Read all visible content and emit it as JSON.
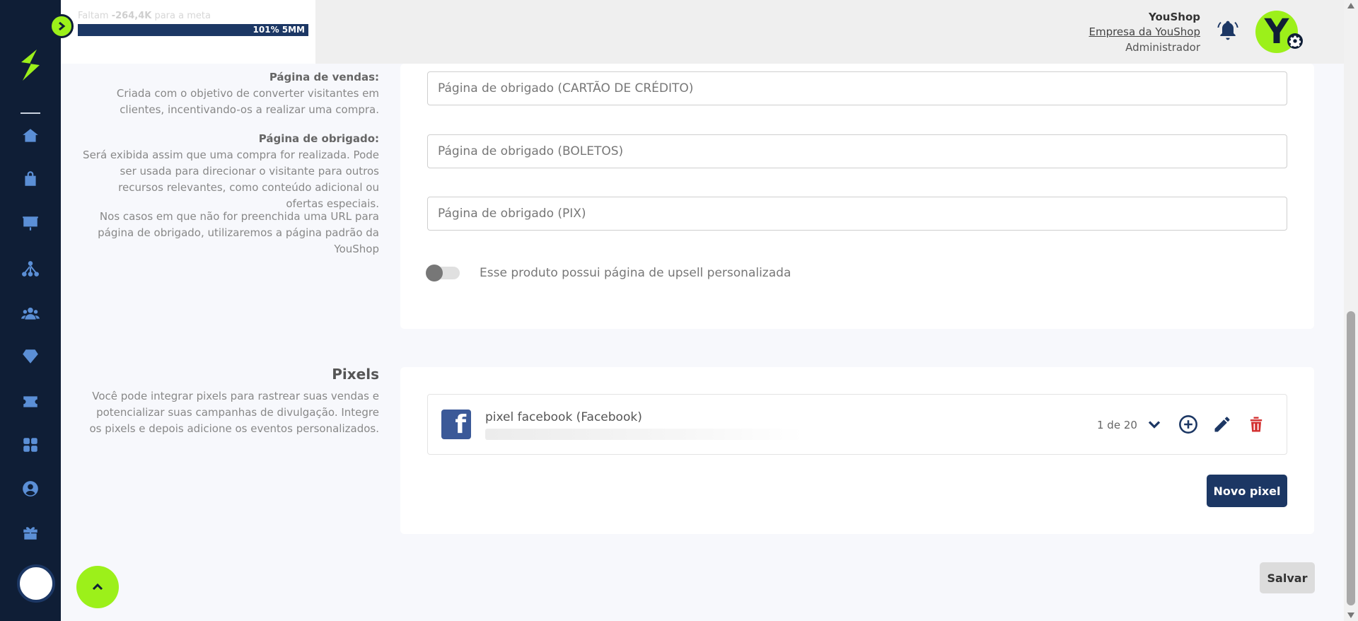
{
  "header": {
    "goal_label_prefix": "Faltam ",
    "goal_amount": "-264,4K",
    "goal_label_suffix": " para a meta",
    "goal_bar_text": "101% 5MM",
    "user_name": "YouShop",
    "company": "Empresa da YouShop",
    "role": "Administrador",
    "avatar_letter": "Y"
  },
  "sidebar": {
    "items": [
      "home-icon",
      "bag-icon",
      "presentation-chart-icon",
      "network-icon",
      "users-icon",
      "diamond-icon",
      "ticket-icon",
      "apps-grid-icon",
      "user-circle-icon",
      "gift-icon"
    ]
  },
  "pages_section": {
    "vendas_title": "Página de vendas:",
    "vendas_text": "Criada com o objetivo de converter visitantes em clientes, incentivando-os a realizar uma compra.",
    "obrigado_title": "Página de obrigado:",
    "obrigado_text": "Será exibida assim que uma compra for realizada. Pode ser usada para direcionar o visitante para outros recursos relevantes, como conteúdo adicional ou ofertas especiais.",
    "default_note": "Nos casos em que não for preenchida uma URL para página de obrigado, utilizaremos a página padrão da YouShop",
    "inputs": [
      {
        "placeholder": "Página de obrigado (CARTÃO DE CRÉDITO)"
      },
      {
        "placeholder": "Página de obrigado (BOLETOS)"
      },
      {
        "placeholder": "Página de obrigado (PIX)"
      }
    ],
    "upsell_toggle_label": "Esse produto possui página de upsell personalizada",
    "upsell_toggle_on": false
  },
  "pixels_section": {
    "title": "Pixels",
    "description": "Você pode integrar pixels para rastrear suas vendas e potencializar suas campanhas de divulgação. Integre os pixels e depois adicione os eventos personalizados.",
    "pixel": {
      "name": "pixel facebook (Facebook)",
      "count": "1 de 20"
    },
    "new_pixel_label": "Novo pixel"
  },
  "footer": {
    "save_label": "Salvar"
  },
  "colors": {
    "sidebar": "#0f1e36",
    "accent_green": "#9cf01a",
    "primary_navy": "#1c3764",
    "danger": "#d32f2f"
  }
}
